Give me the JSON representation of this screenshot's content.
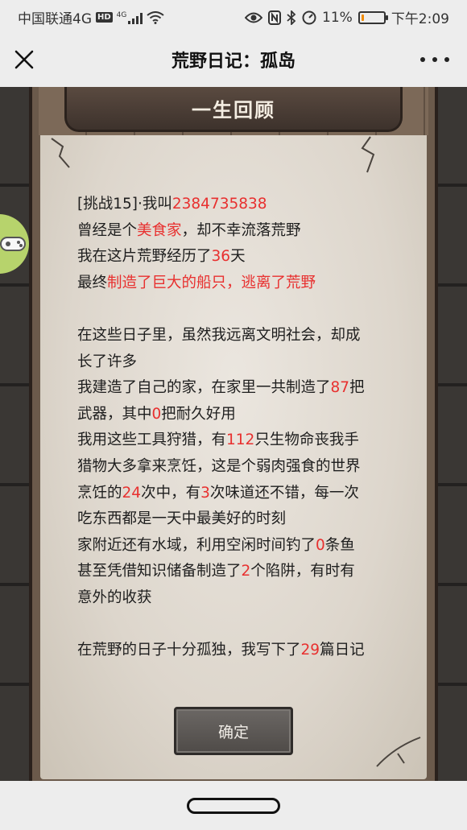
{
  "status_bar": {
    "carrier": "中国联通4G",
    "network_badge": "HD",
    "network_type": "4G",
    "battery_percent": "11%",
    "battery_level": 0.11,
    "time": "下午2:09",
    "icons": [
      "signal-icon",
      "wifi-icon",
      "eye-icon",
      "nfc-icon",
      "bluetooth-icon",
      "speed-icon",
      "battery-icon"
    ]
  },
  "nav": {
    "title": "荒野日记：孤岛",
    "close_icon": "close-icon",
    "more_icon": "more-icon"
  },
  "panel": {
    "title": "一生回顾",
    "confirm_label": "确定",
    "side_tab_icon": "gamepad-icon"
  },
  "summary": {
    "l1_a": "[挑战15]·我叫",
    "l1_b": "2384735838",
    "l2_a": "曾经是个",
    "l2_b": "美食家",
    "l2_c": "，却不幸流落荒野",
    "l3_a": "我在这片荒野经历了",
    "l3_b": "36",
    "l3_c": "天",
    "l4_a": "最终",
    "l4_b": "制造了巨大的船只，逃离了荒野",
    "l5": "在这些日子里，虽然我远离文明社会，却成",
    "l6": "长了许多",
    "l7_a": "我建造了自己的家，在家里一共制造了",
    "l7_b": "87",
    "l7_c": "把",
    "l8_a": "武器，其中",
    "l8_b": "0",
    "l8_c": "把耐久好用",
    "l9_a": "我用这些工具狩猎，有",
    "l9_b": "112",
    "l9_c": "只生物命丧我手",
    "l10": "猎物大多拿来烹饪，这是个弱肉强食的世界",
    "l11_a": "烹饪的",
    "l11_b": "24",
    "l11_c": "次中，有",
    "l11_d": "3",
    "l11_e": "次味道还不错，每一次",
    "l12": "吃东西都是一天中最美好的时刻",
    "l13_a": "家附近还有水域，利用空闲时间钓了",
    "l13_b": "0",
    "l13_c": "条鱼",
    "l14_a": "甚至凭借知识储备制造了",
    "l14_b": "2",
    "l14_c": "个陷阱，有时有",
    "l15": "意外的收获",
    "l16_a": "在荒野的日子十分孤独，我写下了",
    "l16_b": "29",
    "l16_c": "篇日记"
  },
  "colors": {
    "highlight": "#e8302f",
    "side_tab": "#b7d36c",
    "battery_fill": "#f08a00"
  }
}
